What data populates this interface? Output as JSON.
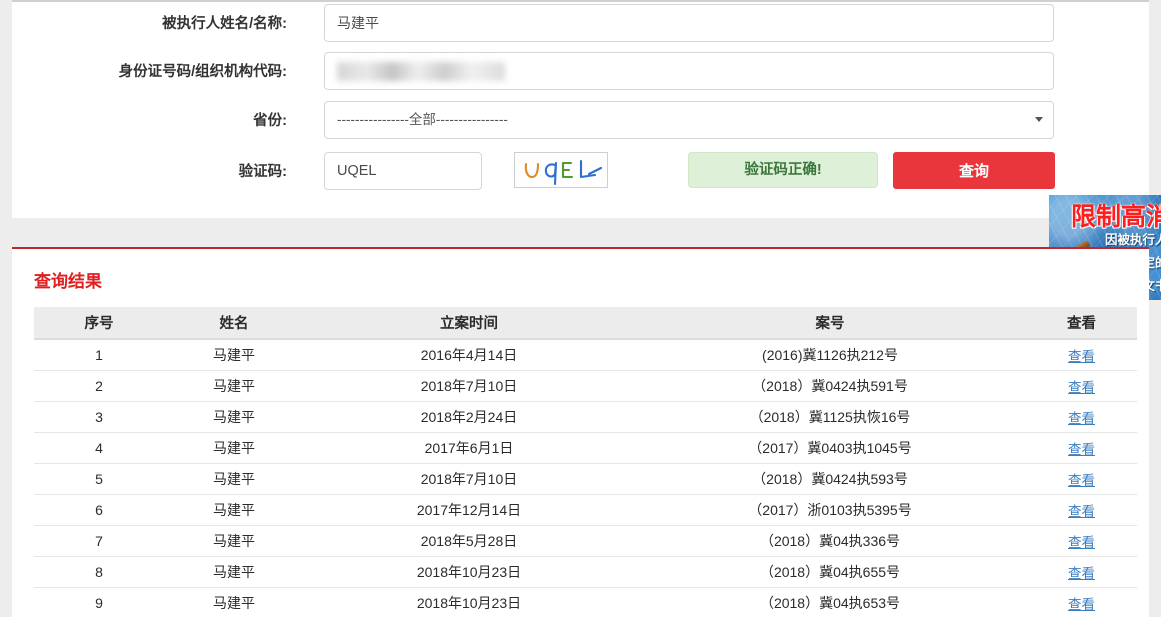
{
  "search_form": {
    "fields": [
      {
        "label": "被执行人姓名/名称:",
        "value": "马建平",
        "placeholder": ""
      },
      {
        "label": "身份证号码/组织机构代码:",
        "value": "",
        "placeholder": ""
      },
      {
        "label": "省份:",
        "value": "----------------全部----------------",
        "placeholder": ""
      },
      {
        "label": "验证码:",
        "value": "UQEL",
        "placeholder": ""
      }
    ],
    "captcha_text": "UQEL",
    "captcha_status": "验证码正确!",
    "submit_label": "查询"
  },
  "ad": {
    "title": "限制高消",
    "line1": "因被执行人",
    "line2": "知书指定的",
    "line3": "效法律文书"
  },
  "results": {
    "title": "查询结果",
    "columns": [
      "序号",
      "姓名",
      "立案时间",
      "案号",
      "查看"
    ],
    "view_label": "查看",
    "rows": [
      {
        "index": "1",
        "name": "马建平",
        "filing_date": "2016年4月14日",
        "case_no": "(2016)冀1126执212号",
        "view": "查看"
      },
      {
        "index": "2",
        "name": "马建平",
        "filing_date": "2018年7月10日",
        "case_no": "（2018）冀0424执591号",
        "view": "查看"
      },
      {
        "index": "3",
        "name": "马建平",
        "filing_date": "2018年2月24日",
        "case_no": "（2018）冀1125执恢16号",
        "view": "查看"
      },
      {
        "index": "4",
        "name": "马建平",
        "filing_date": "2017年6月1日",
        "case_no": "（2017）冀0403执1045号",
        "view": "查看"
      },
      {
        "index": "5",
        "name": "马建平",
        "filing_date": "2018年7月10日",
        "case_no": "（2018）冀0424执593号",
        "view": "查看"
      },
      {
        "index": "6",
        "name": "马建平",
        "filing_date": "2017年12月14日",
        "case_no": "（2017）浙0103执5395号",
        "view": "查看"
      },
      {
        "index": "7",
        "name": "马建平",
        "filing_date": "2018年5月28日",
        "case_no": "（2018）冀04执336号",
        "view": "查看"
      },
      {
        "index": "8",
        "name": "马建平",
        "filing_date": "2018年10月23日",
        "case_no": "（2018）冀04执655号",
        "view": "查看"
      },
      {
        "index": "9",
        "name": "马建平",
        "filing_date": "2018年10月23日",
        "case_no": "（2018）冀04执653号",
        "view": "查看"
      }
    ]
  },
  "colors": {
    "accent_red": "#e8363c",
    "panel_border_red": "#c0272d",
    "link_blue": "#3a7ec0",
    "success_green": "#3c763d",
    "success_bg": "#dff0d8"
  }
}
